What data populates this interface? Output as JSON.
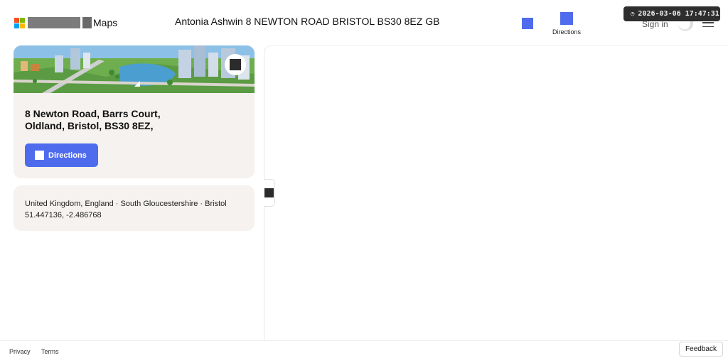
{
  "header": {
    "brand_suffix": "Maps",
    "title": "Antonia Ashwin 8 NEWTON ROAD BRISTOL BS30 8EZ GB",
    "directions_label": "Directions",
    "sign_in_label": "Sign in",
    "timestamp": "2026-03-06 17:47:31",
    "logo_colors": [
      "#f25022",
      "#7fba00",
      "#00a4ef",
      "#ffb900"
    ],
    "accent_color": "#4f6bed"
  },
  "location_card": {
    "address_line1": "8 Newton Road, Barrs Court,",
    "address_line2": "Oldland, Bristol, BS30 8EZ,",
    "directions_button": "Directions"
  },
  "info_card": {
    "region": "United Kingdom, England · South Gloucestershire · Bristol",
    "coordinates": "51.447136, -2.486768"
  },
  "footer": {
    "privacy": "Privacy",
    "terms": "Terms",
    "feedback": "Feedback"
  }
}
